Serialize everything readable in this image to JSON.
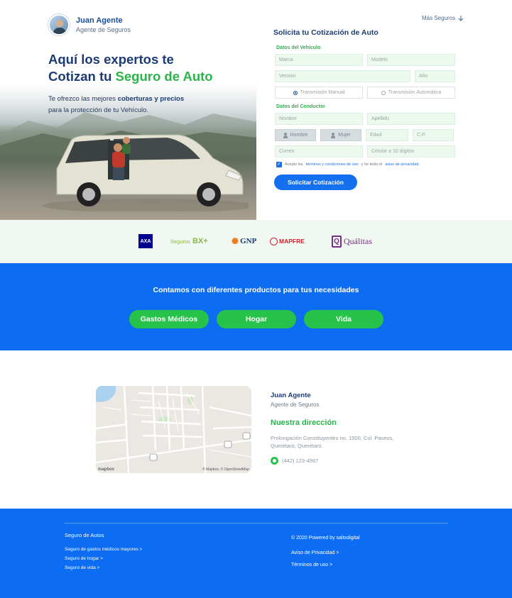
{
  "agent": {
    "name": "Juan Agente",
    "role": "Agente de Seguros"
  },
  "hero": {
    "title_line1": "Aquí los expertos te",
    "title_line2_prefix": "Cotizan tu",
    "title_line2_highlight": "Seguro de Auto",
    "lead_part1": "Te ofrezco las mejores",
    "lead_bold": "coberturas y precios",
    "lead_part2": "para la protección de tu Vehículo."
  },
  "header": {
    "more_link": "Más Seguros"
  },
  "form": {
    "title": "Solicita tu Cotización de Auto",
    "vehicle_section": "Datos del Vehículo",
    "marca": "Marca",
    "modelo": "Modelo",
    "version": "Versión",
    "anio": "Año",
    "trans_manual": "Transmisión Manual",
    "trans_auto": "Transmisión Automática",
    "driver_section": "Datos del Conductor",
    "nombre": "Nombre",
    "apellido": "Apellido",
    "hombre": "Hombre",
    "mujer": "Mujer",
    "edad": "Edad",
    "cp": "C.P.",
    "correo": "Correo",
    "celular": "Celular a 10 dígitos",
    "terms_prefix": "Acepto los",
    "terms_link": "términos y condiciones de uso",
    "terms_mid": "y he leído el",
    "privacy_link": "aviso de privacidad.",
    "submit": "Solicitar Cotización"
  },
  "logos": {
    "axa": "AXA",
    "bx_prefix": "Seguros",
    "bx": "BX+",
    "gnp": "GNP",
    "mapfre": "MAPFRE",
    "qualitas": "Quálitas"
  },
  "products": {
    "title": "Contamos con diferentes productos para tus necesidades",
    "items": [
      "Gastos Médicos",
      "Hogar",
      "Vida"
    ]
  },
  "contact": {
    "name": "Juan Agente",
    "role": "Agente de Seguros",
    "address_title": "Nuestra dirección",
    "address": "Prolongación Constituyentes no. 1500, Col. Paseos, Querétaro, Querétaro.",
    "phone": "(442) 123-4567",
    "map_credit": "© Mapbox, © OpenStreetMap",
    "map_logo": "mapbox"
  },
  "footer": {
    "left_title": "Seguro de Autos",
    "links": [
      "Seguro de gastos médicos mayores >",
      "Seguro de hogar >",
      "Seguro de vida >"
    ],
    "copyright": "© 2020 Powered by saltodigital",
    "privacy": "Aviso de Privacidad >",
    "terms": "Términos de uso >"
  },
  "colors": {
    "brand_blue": "#0c6cf2",
    "accent_green": "#27c24a",
    "title_navy": "#1b3c73"
  }
}
